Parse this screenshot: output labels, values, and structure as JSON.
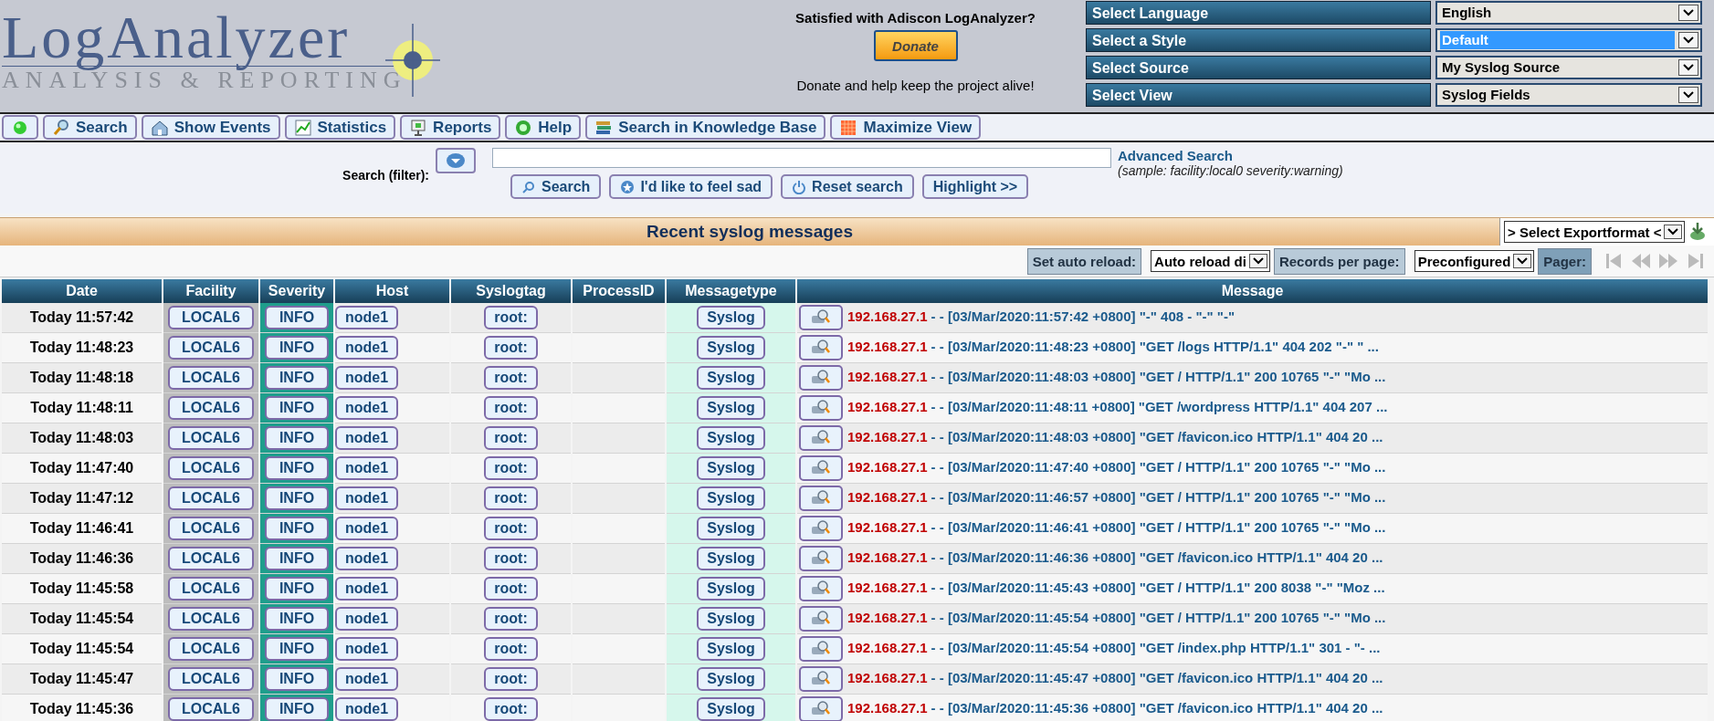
{
  "logo": {
    "title": "LogAnalyzer",
    "subtitle": "ANALYSIS & REPORTING"
  },
  "donate": {
    "question": "Satisfied with Adiscon LogAnalyzer?",
    "button": "Donate",
    "note": "Donate and help keep the project alive!"
  },
  "selectors": [
    {
      "label": "Select Language",
      "value": "English",
      "highlighted": false
    },
    {
      "label": "Select a Style",
      "value": "Default",
      "highlighted": true
    },
    {
      "label": "Select Source",
      "value": "My Syslog Source",
      "highlighted": false
    },
    {
      "label": "Select View",
      "value": "Syslog Fields",
      "highlighted": false
    }
  ],
  "toolbar": [
    {
      "kind": "status"
    },
    {
      "kind": "button",
      "label": "Search"
    },
    {
      "kind": "button",
      "label": "Show Events"
    },
    {
      "kind": "button",
      "label": "Statistics"
    },
    {
      "kind": "button",
      "label": "Reports"
    },
    {
      "kind": "button",
      "label": "Help"
    },
    {
      "kind": "button",
      "label": "Search in Knowledge Base"
    },
    {
      "kind": "button",
      "label": "Maximize View"
    }
  ],
  "search": {
    "label": "Search (filter):",
    "advanced_link": "Advanced Search",
    "sample": "(sample: facility:local0 severity:warning)",
    "buttons": [
      "Search",
      "I'd like to feel sad",
      "Reset search",
      "Highlight >>"
    ]
  },
  "title": "Recent syslog messages",
  "export": {
    "value": "> Select Exportformat <"
  },
  "controls": {
    "reload_label": "Set auto reload:",
    "reload_value": "Auto reload di",
    "records_label": "Records per page:",
    "records_value": "Preconfigured",
    "pager_label": "Pager:"
  },
  "table": {
    "columns": [
      "Date",
      "Facility",
      "Severity",
      "Host",
      "Syslogtag",
      "ProcessID",
      "Messagetype",
      "Message"
    ],
    "rows": [
      {
        "date": "Today 11:57:42",
        "facility": "LOCAL6",
        "severity": "INFO",
        "host": "node1",
        "syslogtag": "root:",
        "messagetype": "Syslog",
        "ip": "192.168.27.1",
        "message": "- - [03/Mar/2020:11:57:42 +0800] \"-\" 408 - \"-\" \"-\""
      },
      {
        "date": "Today 11:48:23",
        "facility": "LOCAL6",
        "severity": "INFO",
        "host": "node1",
        "syslogtag": "root:",
        "messagetype": "Syslog",
        "ip": "192.168.27.1",
        "message": "- - [03/Mar/2020:11:48:23 +0800] \"GET /logs HTTP/1.1\" 404 202 \"-\" \" ..."
      },
      {
        "date": "Today 11:48:18",
        "facility": "LOCAL6",
        "severity": "INFO",
        "host": "node1",
        "syslogtag": "root:",
        "messagetype": "Syslog",
        "ip": "192.168.27.1",
        "message": "- - [03/Mar/2020:11:48:03 +0800] \"GET / HTTP/1.1\" 200 10765 \"-\" \"Mo ..."
      },
      {
        "date": "Today 11:48:11",
        "facility": "LOCAL6",
        "severity": "INFO",
        "host": "node1",
        "syslogtag": "root:",
        "messagetype": "Syslog",
        "ip": "192.168.27.1",
        "message": "- - [03/Mar/2020:11:48:11 +0800] \"GET /wordpress HTTP/1.1\" 404 207 ..."
      },
      {
        "date": "Today 11:48:03",
        "facility": "LOCAL6",
        "severity": "INFO",
        "host": "node1",
        "syslogtag": "root:",
        "messagetype": "Syslog",
        "ip": "192.168.27.1",
        "message": "- - [03/Mar/2020:11:48:03 +0800] \"GET /favicon.ico HTTP/1.1\" 404 20 ..."
      },
      {
        "date": "Today 11:47:40",
        "facility": "LOCAL6",
        "severity": "INFO",
        "host": "node1",
        "syslogtag": "root:",
        "messagetype": "Syslog",
        "ip": "192.168.27.1",
        "message": "- - [03/Mar/2020:11:47:40 +0800] \"GET / HTTP/1.1\" 200 10765 \"-\" \"Mo ..."
      },
      {
        "date": "Today 11:47:12",
        "facility": "LOCAL6",
        "severity": "INFO",
        "host": "node1",
        "syslogtag": "root:",
        "messagetype": "Syslog",
        "ip": "192.168.27.1",
        "message": "- - [03/Mar/2020:11:46:57 +0800] \"GET / HTTP/1.1\" 200 10765 \"-\" \"Mo ..."
      },
      {
        "date": "Today 11:46:41",
        "facility": "LOCAL6",
        "severity": "INFO",
        "host": "node1",
        "syslogtag": "root:",
        "messagetype": "Syslog",
        "ip": "192.168.27.1",
        "message": "- - [03/Mar/2020:11:46:41 +0800] \"GET / HTTP/1.1\" 200 10765 \"-\" \"Mo ..."
      },
      {
        "date": "Today 11:46:36",
        "facility": "LOCAL6",
        "severity": "INFO",
        "host": "node1",
        "syslogtag": "root:",
        "messagetype": "Syslog",
        "ip": "192.168.27.1",
        "message": "- - [03/Mar/2020:11:46:36 +0800] \"GET /favicon.ico HTTP/1.1\" 404 20 ..."
      },
      {
        "date": "Today 11:45:58",
        "facility": "LOCAL6",
        "severity": "INFO",
        "host": "node1",
        "syslogtag": "root:",
        "messagetype": "Syslog",
        "ip": "192.168.27.1",
        "message": "- - [03/Mar/2020:11:45:43 +0800] \"GET / HTTP/1.1\" 200 8038 \"-\" \"Moz ..."
      },
      {
        "date": "Today 11:45:54",
        "facility": "LOCAL6",
        "severity": "INFO",
        "host": "node1",
        "syslogtag": "root:",
        "messagetype": "Syslog",
        "ip": "192.168.27.1",
        "message": "- - [03/Mar/2020:11:45:54 +0800] \"GET / HTTP/1.1\" 200 10765 \"-\" \"Mo ..."
      },
      {
        "date": "Today 11:45:54",
        "facility": "LOCAL6",
        "severity": "INFO",
        "host": "node1",
        "syslogtag": "root:",
        "messagetype": "Syslog",
        "ip": "192.168.27.1",
        "message": "- - [03/Mar/2020:11:45:54 +0800] \"GET /index.php HTTP/1.1\" 301 - \"- ..."
      },
      {
        "date": "Today 11:45:47",
        "facility": "LOCAL6",
        "severity": "INFO",
        "host": "node1",
        "syslogtag": "root:",
        "messagetype": "Syslog",
        "ip": "192.168.27.1",
        "message": "- - [03/Mar/2020:11:45:47 +0800] \"GET /favicon.ico HTTP/1.1\" 404 20 ..."
      },
      {
        "date": "Today 11:45:36",
        "facility": "LOCAL6",
        "severity": "INFO",
        "host": "node1",
        "syslogtag": "root:",
        "messagetype": "Syslog",
        "ip": "192.168.27.1",
        "message": "- - [03/Mar/2020:11:45:36 +0800] \"GET /favicon.ico HTTP/1.1\" 404 20 ..."
      }
    ]
  }
}
